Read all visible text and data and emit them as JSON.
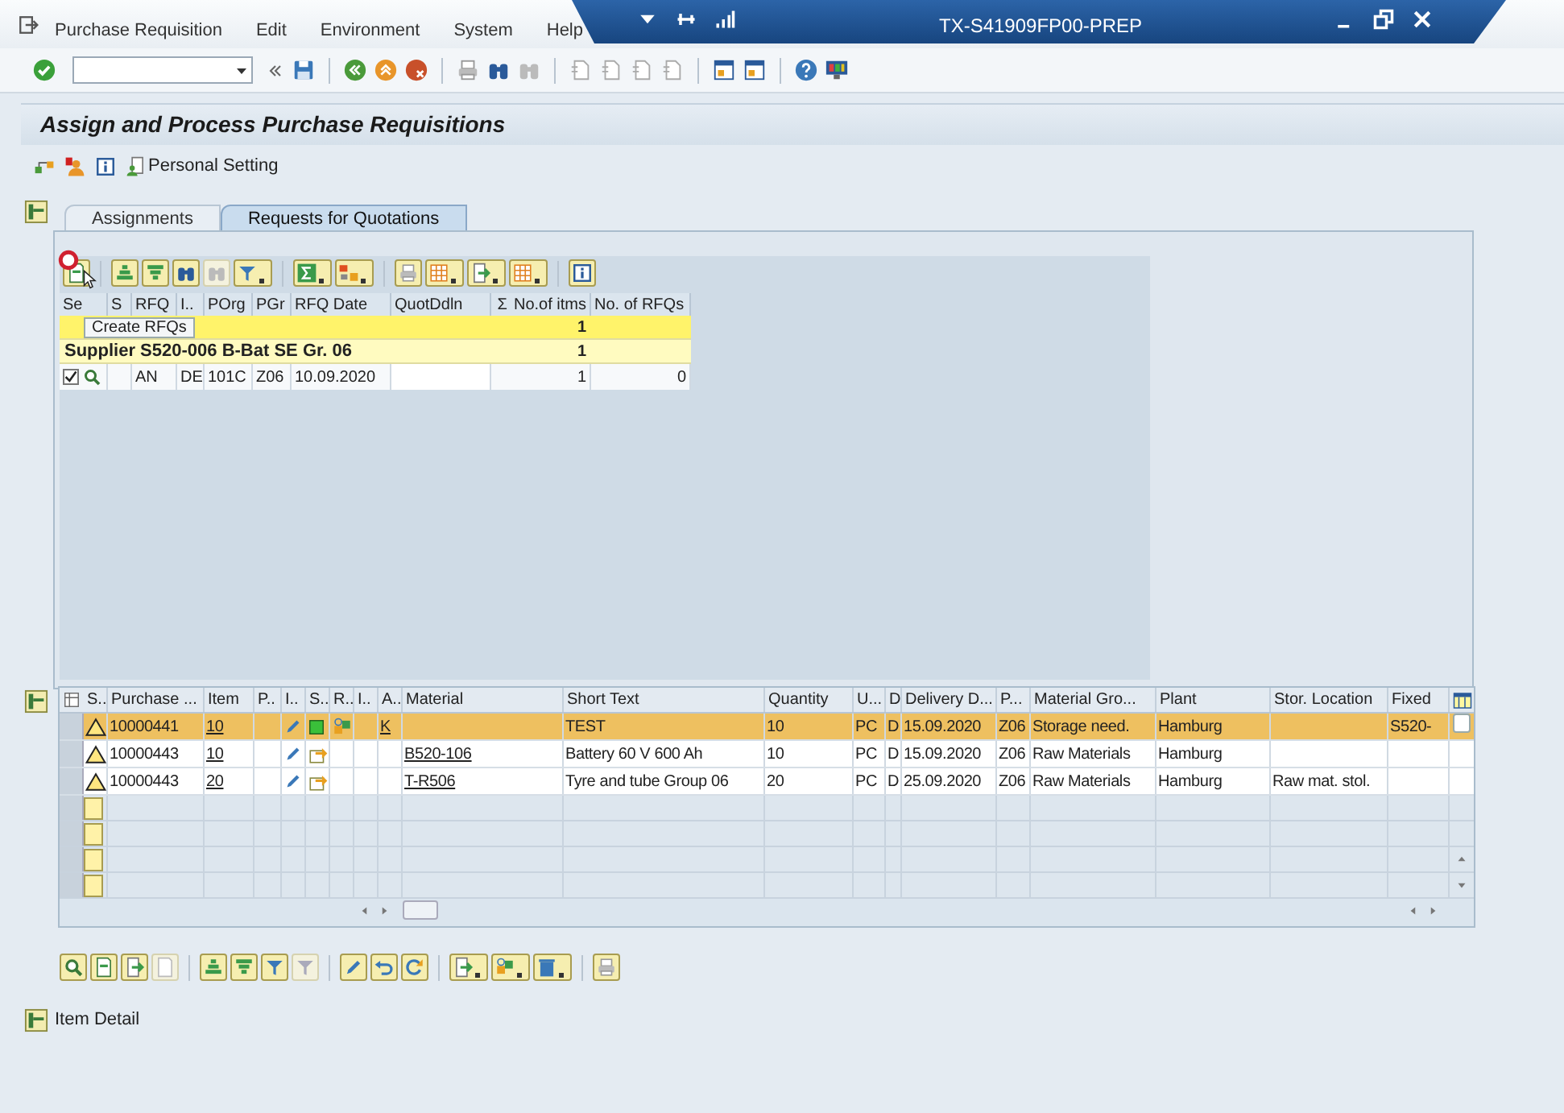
{
  "menu": [
    {
      "label": "Purchase Requisition"
    },
    {
      "label": "Edit"
    },
    {
      "label": "Environment"
    },
    {
      "label": "System"
    },
    {
      "label": "Help"
    }
  ],
  "system": {
    "title": "TX-S41909FP00-PREP"
  },
  "screen_title": "Assign and Process Purchase Requisitions",
  "app_toolbar": {
    "personal_setting": "Personal Setting"
  },
  "tabs": [
    {
      "label": "Assignments",
      "selected": false
    },
    {
      "label": "Requests for Quotations",
      "selected": true
    }
  ],
  "rfq_list": {
    "tooltip": "Create RFQs",
    "columns": [
      {
        "label": "Se"
      },
      {
        "label": "S"
      },
      {
        "label": "RFQ"
      },
      {
        "label": "I.."
      },
      {
        "label": "POrg"
      },
      {
        "label": "PGr"
      },
      {
        "label": "RFQ Date"
      },
      {
        "label": "QuotDdln"
      },
      {
        "label": "No.of itms",
        "sum": "Σ"
      },
      {
        "label": "No. of RFQs"
      }
    ],
    "rows": [
      {
        "kind": "total",
        "count": "1"
      },
      {
        "kind": "subtotal",
        "label": "Supplier S520-006 B-Bat SE Gr. 06",
        "count": "1"
      },
      {
        "kind": "item",
        "checked": true,
        "cells": [
          null,
          null,
          "AN",
          "DE",
          "101C",
          "Z06",
          "10.09.2020",
          null,
          "1",
          "0"
        ]
      }
    ]
  },
  "items": {
    "columns": [
      "S..",
      "Purchase ...",
      "Item",
      "P..",
      "I..",
      "S..",
      "R..",
      "I..",
      "A..",
      "Material",
      "Short Text",
      "Quantity",
      "U...",
      "D",
      "Delivery D...",
      "P...",
      "Material Gro...",
      "Plant",
      "Stor. Location",
      "Fixed"
    ],
    "rows": [
      {
        "selected": true,
        "kind": "assigned",
        "cells": [
          null,
          "10000441",
          "10",
          null,
          null,
          null,
          null,
          null,
          "K",
          null,
          "TEST",
          "10",
          "PC",
          "D",
          "15.09.2020",
          "Z06",
          "Storage need.",
          "Hamburg",
          null,
          "S520-"
        ]
      },
      {
        "selected": false,
        "kind": "open",
        "cells": [
          null,
          "10000443",
          "10",
          null,
          null,
          null,
          null,
          null,
          null,
          "B520-106",
          "Battery 60 V 600 Ah",
          "10",
          "PC",
          "D",
          "15.09.2020",
          "Z06",
          "Raw Materials",
          "Hamburg",
          null,
          null
        ]
      },
      {
        "selected": false,
        "kind": "open",
        "cells": [
          null,
          "10000443",
          "20",
          null,
          null,
          null,
          null,
          null,
          null,
          "T-R506",
          "Tyre and tube Group 06",
          "20",
          "PC",
          "D",
          "25.09.2020",
          "Z06",
          "Raw Materials",
          "Hamburg",
          "Raw mat. stol.",
          null
        ]
      }
    ]
  },
  "item_detail": {
    "label": "Item Detail"
  }
}
